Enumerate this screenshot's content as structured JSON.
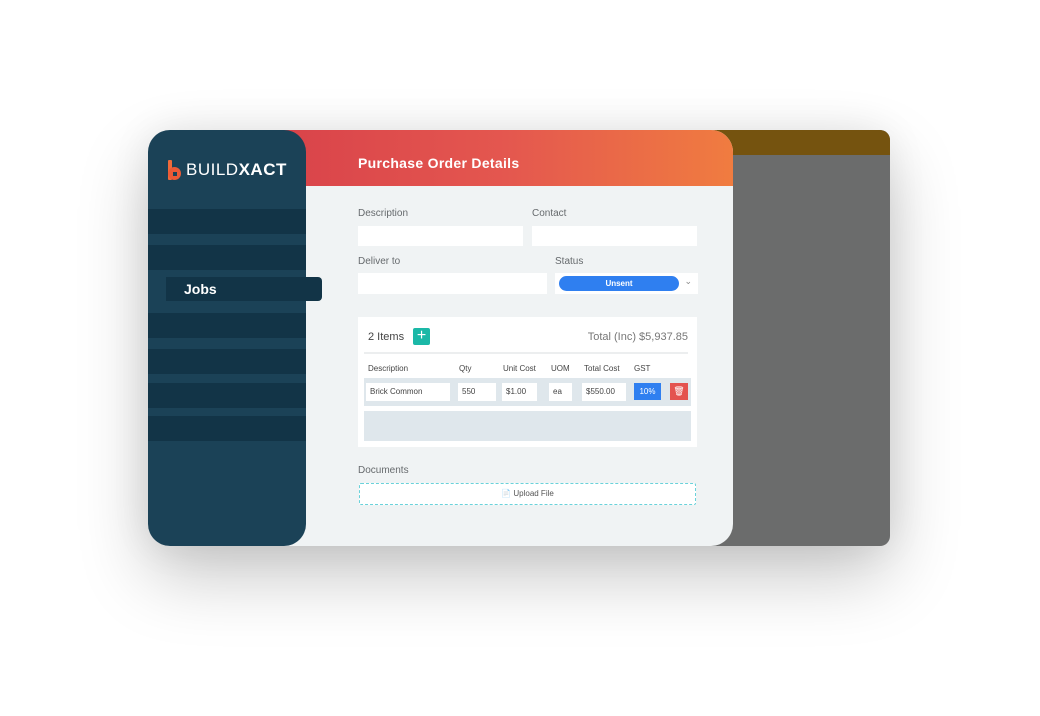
{
  "brand": {
    "name_light": "BUILD",
    "name_bold": "XACT",
    "accent": "#f06a3a"
  },
  "sidebar": {
    "active_item": "Jobs",
    "color": "#1b4257"
  },
  "header": {
    "title": "Purchase Order Details"
  },
  "form": {
    "description_label": "Description",
    "description_value": "",
    "contact_label": "Contact",
    "contact_value": "",
    "deliver_label": "Deliver to",
    "deliver_value": "",
    "status_label": "Status",
    "status_value": "Unsent"
  },
  "items": {
    "count_label": "2 Items",
    "add_icon": "plus-icon",
    "total_label": "Total (Inc) $5,937.85",
    "columns": [
      "Description",
      "Qty",
      "Unit Cost",
      "UOM",
      "Total Cost",
      "GST"
    ],
    "rows": [
      {
        "description": "Brick Common",
        "qty": "550",
        "unit_cost": "$1.00",
        "uom": "ea",
        "total_cost": "$550.00",
        "gst": "10%"
      }
    ]
  },
  "documents": {
    "label": "Documents",
    "upload_label": "Upload File",
    "upload_icon": "file-icon"
  }
}
